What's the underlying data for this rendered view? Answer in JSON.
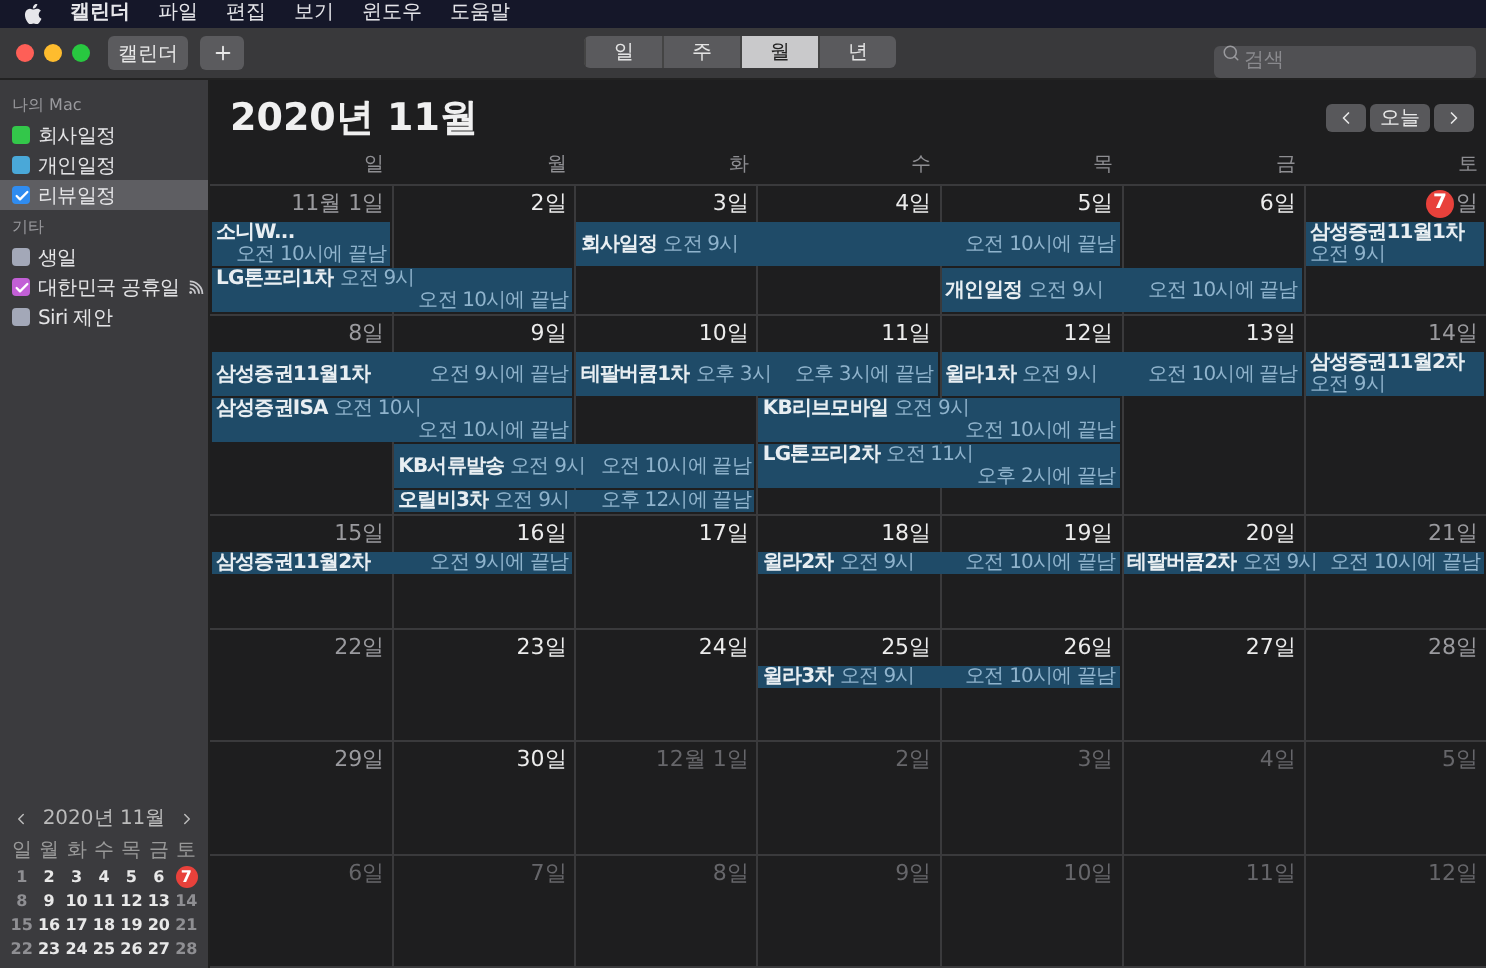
{
  "menu_bar": {
    "app": "캘린더",
    "items": [
      "파일",
      "편집",
      "보기",
      "윈도우",
      "도움말"
    ]
  },
  "toolbar": {
    "calendars_button": "캘린더",
    "view_tabs": [
      {
        "label": "일",
        "selected": false
      },
      {
        "label": "주",
        "selected": false
      },
      {
        "label": "월",
        "selected": true
      },
      {
        "label": "년",
        "selected": false
      }
    ],
    "search": {
      "placeholder": "검색"
    }
  },
  "sidebar": {
    "groups": [
      {
        "heading": "나의 Mac",
        "items": [
          {
            "label": "회사일정",
            "color": "#33c74a",
            "checked": false,
            "selected": false,
            "subscribed": false
          },
          {
            "label": "개인일정",
            "color": "#4aa8d8",
            "checked": false,
            "selected": false,
            "subscribed": false
          },
          {
            "label": "리뷰일정",
            "color": "#2f8cf0",
            "checked": true,
            "selected": true,
            "subscribed": false
          }
        ]
      },
      {
        "heading": "기타",
        "items": [
          {
            "label": "생일",
            "color": "#a3a8b8",
            "checked": false,
            "selected": false,
            "subscribed": false
          },
          {
            "label": "대한민국 공휴일",
            "color": "#c25fd6",
            "checked": true,
            "selected": false,
            "subscribed": true
          },
          {
            "label": "Siri 제안",
            "color": "#a3a8b8",
            "checked": false,
            "selected": false,
            "subscribed": false
          }
        ]
      }
    ],
    "mini_calendar": {
      "title": "2020년 11월",
      "weekdays": [
        "일",
        "월",
        "화",
        "수",
        "목",
        "금",
        "토"
      ],
      "weeks": [
        [
          {
            "label": "1",
            "kind": "weekend"
          },
          {
            "label": "2",
            "kind": "weekday"
          },
          {
            "label": "3",
            "kind": "weekday"
          },
          {
            "label": "4",
            "kind": "weekday"
          },
          {
            "label": "5",
            "kind": "weekday"
          },
          {
            "label": "6",
            "kind": "weekday"
          },
          {
            "label": "7",
            "kind": "today"
          }
        ],
        [
          {
            "label": "8",
            "kind": "weekend"
          },
          {
            "label": "9",
            "kind": "weekday"
          },
          {
            "label": "10",
            "kind": "weekday"
          },
          {
            "label": "11",
            "kind": "weekday"
          },
          {
            "label": "12",
            "kind": "weekday"
          },
          {
            "label": "13",
            "kind": "weekday"
          },
          {
            "label": "14",
            "kind": "weekend"
          }
        ],
        [
          {
            "label": "15",
            "kind": "weekend"
          },
          {
            "label": "16",
            "kind": "weekday"
          },
          {
            "label": "17",
            "kind": "weekday"
          },
          {
            "label": "18",
            "kind": "weekday"
          },
          {
            "label": "19",
            "kind": "weekday"
          },
          {
            "label": "20",
            "kind": "weekday"
          },
          {
            "label": "21",
            "kind": "weekend"
          }
        ],
        [
          {
            "label": "22",
            "kind": "weekend"
          },
          {
            "label": "23",
            "kind": "weekday"
          },
          {
            "label": "24",
            "kind": "weekday"
          },
          {
            "label": "25",
            "kind": "weekday"
          },
          {
            "label": "26",
            "kind": "weekday"
          },
          {
            "label": "27",
            "kind": "weekday"
          },
          {
            "label": "28",
            "kind": "weekend"
          }
        ]
      ]
    }
  },
  "month": {
    "title": "2020년 11월",
    "today_button": "오늘",
    "weekdays": [
      "일",
      "월",
      "화",
      "수",
      "목",
      "금",
      "토"
    ],
    "weeks": [
      {
        "days": [
          {
            "label": "11월 1일",
            "kind": "weekend"
          },
          {
            "label": "2일",
            "kind": "weekday"
          },
          {
            "label": "3일",
            "kind": "weekday"
          },
          {
            "label": "4일",
            "kind": "weekday"
          },
          {
            "label": "5일",
            "kind": "weekday"
          },
          {
            "label": "6일",
            "kind": "weekday"
          },
          {
            "label": "일",
            "kind": "today",
            "badge": "7"
          }
        ],
        "lanes": [
          [
            {
              "kind": "event",
              "title": "소니W...",
              "end": "오전 10시에 끝남"
            },
            {
              "kind": "empty"
            },
            {
              "kind": "event",
              "title": "회사일정",
              "time": "오전 9시",
              "end": "오전 10시에 끝남"
            },
            {
              "kind": "continued"
            },
            {
              "kind": "continued"
            },
            {
              "kind": "empty"
            },
            {
              "kind": "event",
              "title": "삼성증권11월1차",
              "time": "오전 9시"
            }
          ],
          [
            {
              "kind": "event",
              "title": "LG톤프리1차",
              "time": "오전 9시",
              "end": "오전 10시에 끝남"
            },
            {
              "kind": "continued"
            },
            {
              "kind": "empty"
            },
            {
              "kind": "empty"
            },
            {
              "kind": "event",
              "title": "개인일정",
              "time": "오전 9시",
              "end": "오전 10시에 끝남"
            },
            {
              "kind": "continued"
            }
          ]
        ]
      },
      {
        "days": [
          {
            "label": "8일",
            "kind": "weekend"
          },
          {
            "label": "9일",
            "kind": "weekday"
          },
          {
            "label": "10일",
            "kind": "weekday"
          },
          {
            "label": "11일",
            "kind": "weekday"
          },
          {
            "label": "12일",
            "kind": "weekday"
          },
          {
            "label": "13일",
            "kind": "weekday"
          },
          {
            "label": "14일",
            "kind": "weekend"
          }
        ],
        "lanes": [
          [
            {
              "kind": "event",
              "title": "삼성증권11월1차",
              "end": "오전 9시에 끝남"
            },
            {
              "kind": "continued"
            },
            {
              "kind": "event",
              "title": "테팔버큠1차",
              "time": "오후 3시",
              "end": "오후 3시에 끝남"
            },
            {
              "kind": "continued"
            },
            {
              "kind": "event",
              "title": "윌라1차",
              "time": "오전 9시",
              "end": "오전 10시에 끝남"
            },
            {
              "kind": "continued"
            },
            {
              "kind": "event",
              "title": "삼성증권11월2차",
              "time": "오전 9시"
            }
          ],
          [
            {
              "kind": "event",
              "title": "삼성증권ISA",
              "time": "오전 10시",
              "end": "오전 10시에 끝남"
            },
            {
              "kind": "continued"
            },
            {
              "kind": "empty"
            },
            {
              "kind": "event",
              "title": "KB리브모바일",
              "time": "오전 9시",
              "end": "오전 10시에 끝남"
            },
            {
              "kind": "continued"
            }
          ],
          [
            {
              "kind": "empty"
            },
            {
              "kind": "event",
              "title": "KB서류발송",
              "time": "오전 9시",
              "end": "오전 10시에 끝남"
            },
            {
              "kind": "continued"
            },
            {
              "kind": "event",
              "title": "LG톤프리2차",
              "time": "오전 11시",
              "end": "오후 2시에 끝남"
            },
            {
              "kind": "continued"
            }
          ],
          [
            {
              "kind": "empty"
            },
            {
              "kind": "event",
              "title": "오릴비3차",
              "time": "오전 9시",
              "end": "오후 12시에 끝남"
            },
            {
              "kind": "continued"
            }
          ]
        ]
      },
      {
        "days": [
          {
            "label": "15일",
            "kind": "weekend"
          },
          {
            "label": "16일",
            "kind": "weekday"
          },
          {
            "label": "17일",
            "kind": "weekday"
          },
          {
            "label": "18일",
            "kind": "weekday"
          },
          {
            "label": "19일",
            "kind": "weekday"
          },
          {
            "label": "20일",
            "kind": "weekday"
          },
          {
            "label": "21일",
            "kind": "weekend"
          }
        ],
        "lanes": [
          [
            {
              "kind": "event",
              "title": "삼성증권11월2차",
              "end": "오전 9시에 끝남"
            },
            {
              "kind": "continued"
            },
            {
              "kind": "empty"
            },
            {
              "kind": "event",
              "title": "윌라2차",
              "time": "오전 9시",
              "end": "오전 10시에 끝남"
            },
            {
              "kind": "continued"
            },
            {
              "kind": "event",
              "title": "테팔버큠2차",
              "time": "오전 9시",
              "end": "오전 10시에 끝남"
            },
            {
              "kind": "continued"
            }
          ]
        ]
      },
      {
        "days": [
          {
            "label": "22일",
            "kind": "weekend"
          },
          {
            "label": "23일",
            "kind": "weekday"
          },
          {
            "label": "24일",
            "kind": "weekday"
          },
          {
            "label": "25일",
            "kind": "weekday"
          },
          {
            "label": "26일",
            "kind": "weekday"
          },
          {
            "label": "27일",
            "kind": "weekday"
          },
          {
            "label": "28일",
            "kind": "weekend"
          }
        ],
        "lanes": [
          [
            {
              "kind": "empty"
            },
            {
              "kind": "empty"
            },
            {
              "kind": "empty"
            },
            {
              "kind": "event",
              "title": "윌라3차",
              "time": "오전 9시",
              "end": "오전 10시에 끝남"
            },
            {
              "kind": "continued"
            }
          ]
        ]
      },
      {
        "days": [
          {
            "label": "29일",
            "kind": "weekend"
          },
          {
            "label": "30일",
            "kind": "weekday"
          },
          {
            "label": "12월 1일",
            "kind": "outside"
          },
          {
            "label": "2일",
            "kind": "outside"
          },
          {
            "label": "3일",
            "kind": "outside"
          },
          {
            "label": "4일",
            "kind": "outside"
          },
          {
            "label": "5일",
            "kind": "outside"
          }
        ]
      },
      {
        "days": [
          {
            "label": "6일",
            "kind": "outside"
          },
          {
            "label": "7일",
            "kind": "outside"
          },
          {
            "label": "8일",
            "kind": "outside"
          },
          {
            "label": "9일",
            "kind": "outside"
          },
          {
            "label": "10일",
            "kind": "outside"
          },
          {
            "label": "11일",
            "kind": "outside"
          },
          {
            "label": "12일",
            "kind": "outside"
          }
        ]
      }
    ]
  }
}
